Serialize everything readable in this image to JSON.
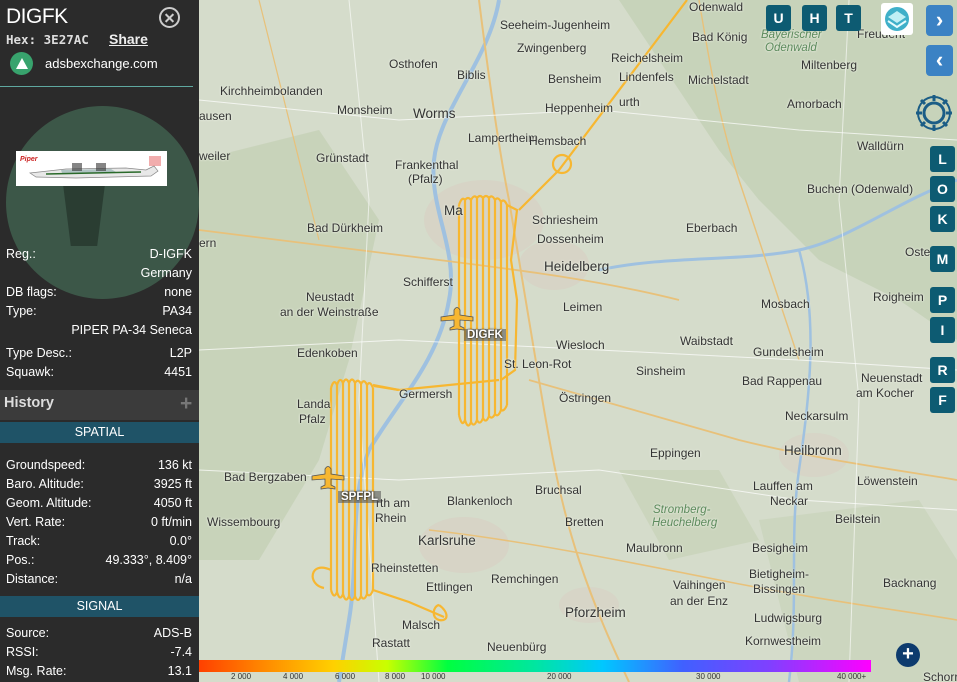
{
  "aircraft": {
    "callsign": "DIGFK",
    "hex_label": "Hex:",
    "hex": "3E27AC",
    "share_label": "Share",
    "site": "adsbexchange.com"
  },
  "details": [
    {
      "label": "Reg.:",
      "value": "D-IGFK"
    },
    {
      "label": "",
      "value": "Germany"
    },
    {
      "label": "DB flags:",
      "value": "none"
    },
    {
      "label": "Type:",
      "value": "PA34"
    },
    {
      "label": "",
      "value": "PIPER PA-34 Seneca"
    },
    {
      "label": "Type Desc.:",
      "value": "L2P"
    },
    {
      "label": "Squawk:",
      "value": "4451"
    }
  ],
  "history": {
    "title": "History",
    "expand_icon": "plus-icon"
  },
  "spatial": {
    "title": "SPATIAL",
    "rows": [
      {
        "label": "Groundspeed:",
        "value": "136 kt"
      },
      {
        "label": "Baro. Altitude:",
        "value": "3925 ft"
      },
      {
        "label": "Geom. Altitude:",
        "value": "4050 ft"
      },
      {
        "label": "Vert. Rate:",
        "value": "0 ft/min"
      },
      {
        "label": "Track:",
        "value": "0.0°"
      },
      {
        "label": "Pos.:",
        "value": "49.333°, 8.409°"
      },
      {
        "label": "Distance:",
        "value": "n/a"
      }
    ]
  },
  "signal": {
    "title": "SIGNAL",
    "rows": [
      {
        "label": "Source:",
        "value": "ADS-B"
      },
      {
        "label": "RSSI:",
        "value": "-7.4"
      },
      {
        "label": "Msg. Rate:",
        "value": "13.1"
      }
    ]
  },
  "map": {
    "track_color": "#f7b731",
    "top_buttons": [
      "U",
      "H",
      "T"
    ],
    "side_buttons": [
      "L",
      "O",
      "K",
      "M",
      "P",
      "I",
      "R",
      "F"
    ],
    "aircraft_labels": {
      "primary": "DIGFK",
      "secondary": "SPFPL"
    },
    "places": [
      {
        "name": "Odenwald",
        "cls": "place"
      },
      {
        "name": "Seeheim-Jugenheim",
        "cls": "place"
      },
      {
        "name": "Zwingenberg",
        "cls": "place"
      },
      {
        "name": "Bad König",
        "cls": "place"
      },
      {
        "name": "Bayerischer",
        "cls": "place green"
      },
      {
        "name": "Odenwald",
        "cls": "place green"
      },
      {
        "name": "Freudent",
        "cls": "place"
      },
      {
        "name": "Osthofen",
        "cls": "place"
      },
      {
        "name": "Biblis",
        "cls": "place"
      },
      {
        "name": "Reichelsheim",
        "cls": "place"
      },
      {
        "name": "Bensheim",
        "cls": "place"
      },
      {
        "name": "Lindenfels",
        "cls": "place"
      },
      {
        "name": "Michelstadt",
        "cls": "place"
      },
      {
        "name": "Miltenberg",
        "cls": "place"
      },
      {
        "name": "Kirchheimbolanden",
        "cls": "place"
      },
      {
        "name": "Monsheim",
        "cls": "place"
      },
      {
        "name": "Worms",
        "cls": "place big"
      },
      {
        "name": "Heppenheim",
        "cls": "place"
      },
      {
        "name": "urth",
        "cls": "place"
      },
      {
        "name": "Amorbach",
        "cls": "place"
      },
      {
        "name": "ausen",
        "cls": "place"
      },
      {
        "name": "Lampertheim",
        "cls": "place"
      },
      {
        "name": "Hemsbach",
        "cls": "place"
      },
      {
        "name": "Walldürn",
        "cls": "place"
      },
      {
        "name": "weiler",
        "cls": "place"
      },
      {
        "name": "Grünstadt",
        "cls": "place"
      },
      {
        "name": "Frankenthal",
        "cls": "place"
      },
      {
        "name": "(Pfalz)",
        "cls": "place"
      },
      {
        "name": "Buchen (Odenwald)",
        "cls": "place"
      },
      {
        "name": "Ma",
        "cls": "place big"
      },
      {
        "name": "Schriesheim",
        "cls": "place"
      },
      {
        "name": "Bad Dürkheim",
        "cls": "place"
      },
      {
        "name": "Dossenheim",
        "cls": "place"
      },
      {
        "name": "Eberbach",
        "cls": "place"
      },
      {
        "name": "ern",
        "cls": "place"
      },
      {
        "name": "Heidelberg",
        "cls": "place big"
      },
      {
        "name": "Osterbur",
        "cls": "place"
      },
      {
        "name": "Schifferst",
        "cls": "place"
      },
      {
        "name": "Neustadt",
        "cls": "place"
      },
      {
        "name": "an der Weinstraße",
        "cls": "place"
      },
      {
        "name": "Leimen",
        "cls": "place"
      },
      {
        "name": "Mosbach",
        "cls": "place"
      },
      {
        "name": "Roigheim",
        "cls": "place"
      },
      {
        "name": "Wiesloch",
        "cls": "place"
      },
      {
        "name": "Waibstadt",
        "cls": "place"
      },
      {
        "name": "Gundelsheim",
        "cls": "place"
      },
      {
        "name": "Edenkoben",
        "cls": "place"
      },
      {
        "name": "St. Leon-Rot",
        "cls": "place"
      },
      {
        "name": "Sinsheim",
        "cls": "place"
      },
      {
        "name": "Neuenstadt",
        "cls": "place"
      },
      {
        "name": "am Kocher",
        "cls": "place"
      },
      {
        "name": "Germersh",
        "cls": "place"
      },
      {
        "name": "Bad Rappenau",
        "cls": "place"
      },
      {
        "name": "Landa",
        "cls": "place"
      },
      {
        "name": "Pfalz",
        "cls": "place"
      },
      {
        "name": "Östringen",
        "cls": "place"
      },
      {
        "name": "Neckarsulm",
        "cls": "place"
      },
      {
        "name": "Eppingen",
        "cls": "place"
      },
      {
        "name": "Heilbronn",
        "cls": "place big"
      },
      {
        "name": "Bad Bergzaben",
        "cls": "place"
      },
      {
        "name": "Bruchsal",
        "cls": "place"
      },
      {
        "name": "Lauffen am",
        "cls": "place"
      },
      {
        "name": "Neckar",
        "cls": "place"
      },
      {
        "name": "Löwenstein",
        "cls": "place"
      },
      {
        "name": "rth am",
        "cls": "place"
      },
      {
        "name": "Rhein",
        "cls": "place"
      },
      {
        "name": "Blankenloch",
        "cls": "place"
      },
      {
        "name": "Stromberg-",
        "cls": "place green"
      },
      {
        "name": "Heuchelberg",
        "cls": "place green"
      },
      {
        "name": "Wissembourg",
        "cls": "place"
      },
      {
        "name": "Bretten",
        "cls": "place"
      },
      {
        "name": "Beilstein",
        "cls": "place"
      },
      {
        "name": "Karlsruhe",
        "cls": "place big"
      },
      {
        "name": "Maulbronn",
        "cls": "place"
      },
      {
        "name": "Besigheim",
        "cls": "place"
      },
      {
        "name": "Rheinstetten",
        "cls": "place"
      },
      {
        "name": "Ettlingen",
        "cls": "place"
      },
      {
        "name": "Bietigheim-",
        "cls": "place"
      },
      {
        "name": "Bissingen",
        "cls": "place"
      },
      {
        "name": "Remchingen",
        "cls": "place"
      },
      {
        "name": "Vaihingen",
        "cls": "place"
      },
      {
        "name": "an der Enz",
        "cls": "place"
      },
      {
        "name": "Backnang",
        "cls": "place"
      },
      {
        "name": "Malsch",
        "cls": "place"
      },
      {
        "name": "Pforzheim",
        "cls": "place big"
      },
      {
        "name": "Ludwigsburg",
        "cls": "place"
      },
      {
        "name": "Rastatt",
        "cls": "place"
      },
      {
        "name": "Neuenbürg",
        "cls": "place"
      },
      {
        "name": "Kornwestheim",
        "cls": "place"
      },
      {
        "name": "Schorr",
        "cls": "place"
      }
    ],
    "altitude_ticks": [
      "2 000",
      "4 000",
      "6 000",
      "8 000",
      "10 000",
      "20 000",
      "30 000",
      "40 000+"
    ]
  }
}
